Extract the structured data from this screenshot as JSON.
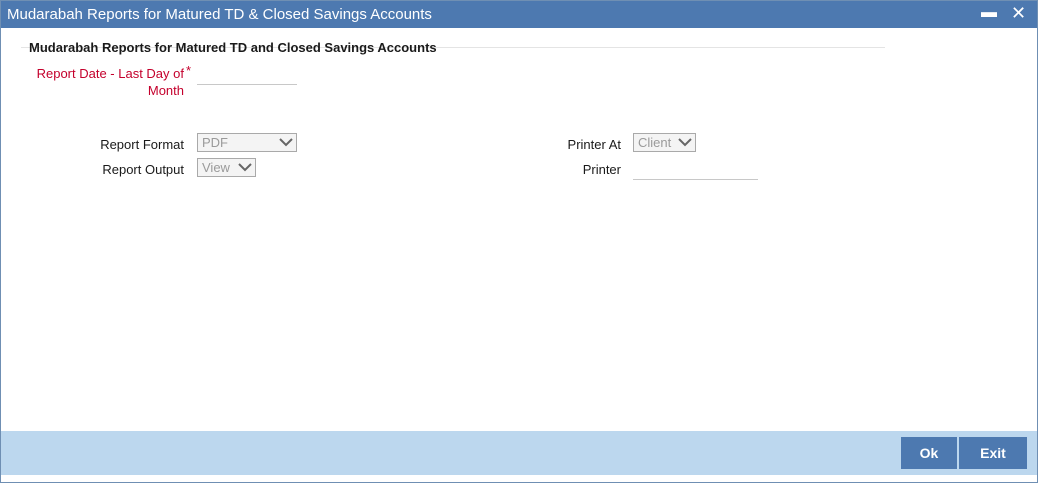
{
  "window": {
    "title": "Mudarabah Reports for Matured TD & Closed Savings Accounts",
    "minimize_glyph": "▬",
    "close_glyph": "✕"
  },
  "section": {
    "title": "Mudarabah Reports for Matured TD and Closed Savings Accounts"
  },
  "fields": {
    "report_date": {
      "label_line1": "Report Date - Last Day of",
      "label_line2": "Month",
      "required_mark": "*",
      "value": ""
    },
    "report_format": {
      "label": "Report Format",
      "value": "PDF"
    },
    "report_output": {
      "label": "Report Output",
      "value": "View"
    },
    "printer_at": {
      "label": "Printer At",
      "value": "Client"
    },
    "printer": {
      "label": "Printer",
      "value": ""
    }
  },
  "footer": {
    "ok_label": "Ok",
    "exit_label": "Exit"
  },
  "colors": {
    "titlebar": "#4d79b0",
    "footer": "#bcd7ee",
    "button": "#4d79b0",
    "required": "#c4002c"
  },
  "icons": {
    "minimize": "minimize-icon",
    "close": "close-icon",
    "dropdown": "chevron-down-icon"
  }
}
